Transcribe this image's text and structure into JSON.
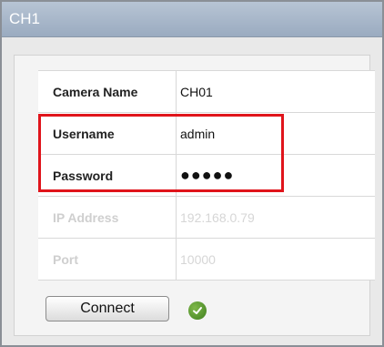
{
  "window": {
    "title": "CH1"
  },
  "fields": [
    {
      "label": "Camera Name",
      "value": "CH01",
      "enabled": true
    },
    {
      "label": "Username",
      "value": "admin",
      "enabled": true
    },
    {
      "label": "Password",
      "value": "●●●●●",
      "enabled": true
    },
    {
      "label": "IP Address",
      "value": "192.168.0.79",
      "enabled": false
    },
    {
      "label": "Port",
      "value": "10000",
      "enabled": false
    }
  ],
  "actions": {
    "connect_label": "Connect"
  },
  "status": {
    "icon": "checkmark-icon",
    "color": "#4e8f2a"
  },
  "colors": {
    "highlight": "#e0141b",
    "titlebar": "#a8b7c9"
  }
}
